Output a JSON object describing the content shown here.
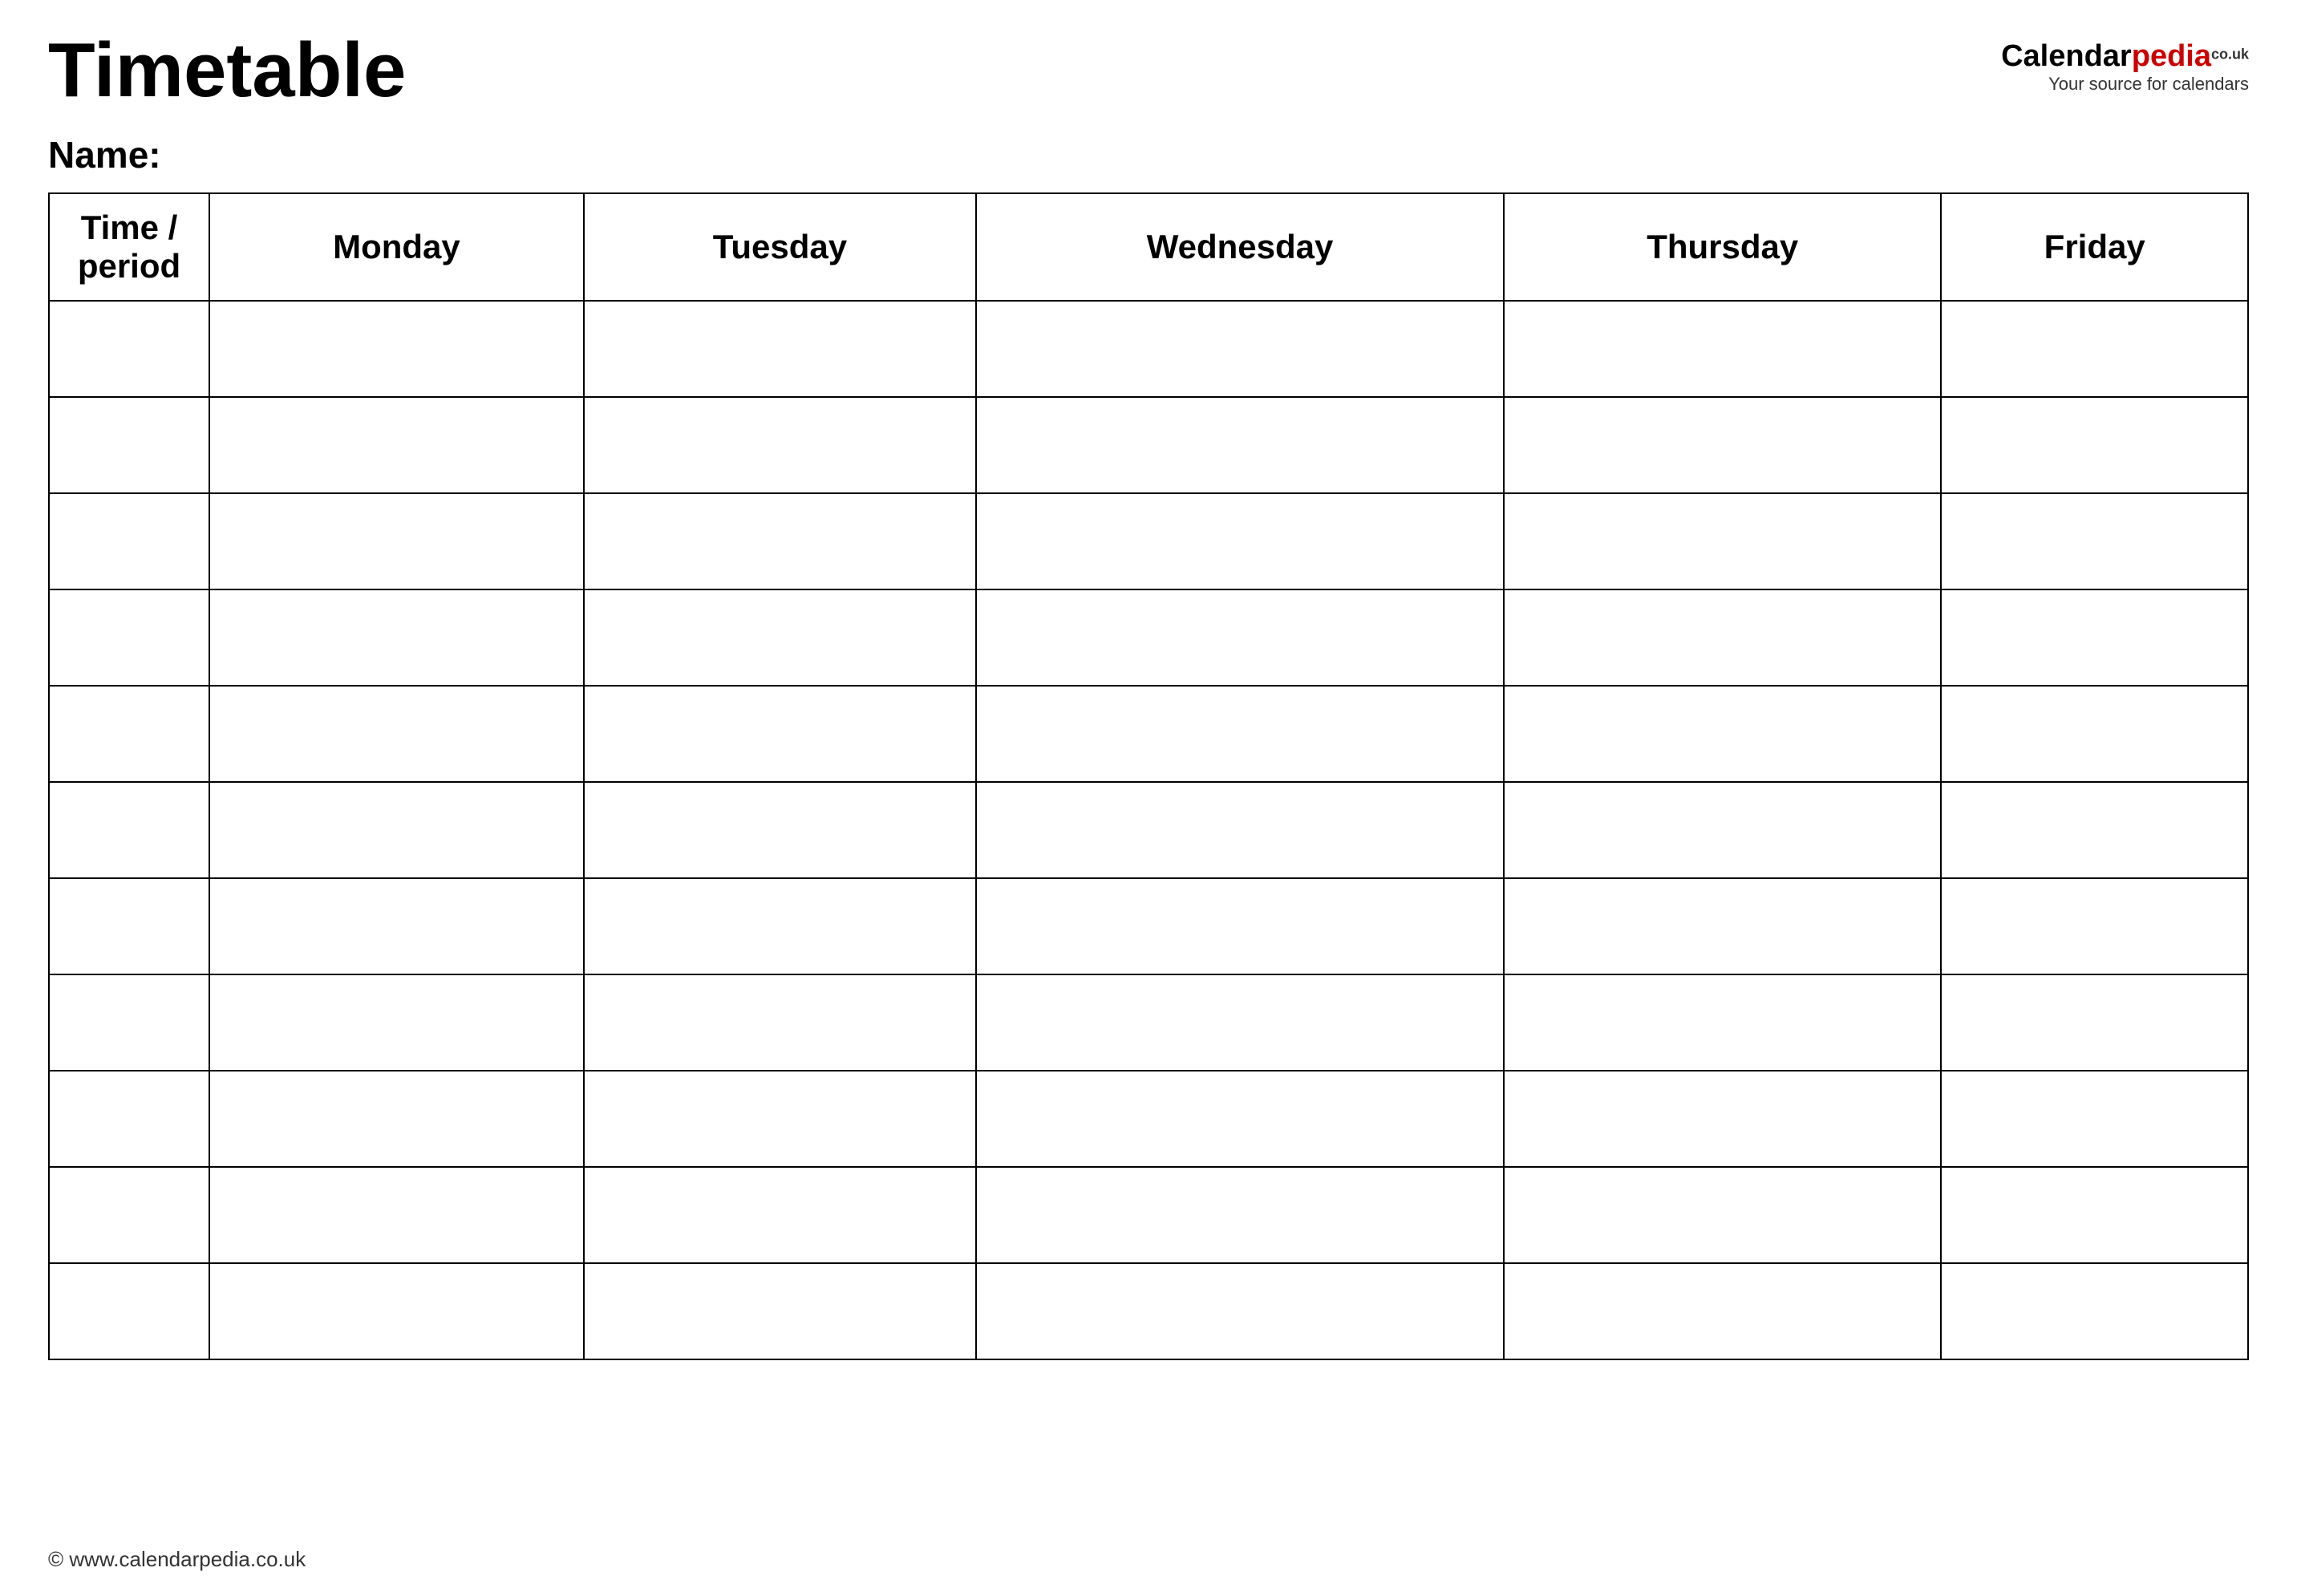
{
  "header": {
    "title": "Timetable",
    "logo": {
      "calendar": "Calendar",
      "pedia": "pedia",
      "couk": "co.uk",
      "tagline": "Your source for calendars"
    }
  },
  "name_label": "Name:",
  "table": {
    "columns": [
      {
        "key": "time",
        "label": "Time / period"
      },
      {
        "key": "monday",
        "label": "Monday"
      },
      {
        "key": "tuesday",
        "label": "Tuesday"
      },
      {
        "key": "wednesday",
        "label": "Wednesday"
      },
      {
        "key": "thursday",
        "label": "Thursday"
      },
      {
        "key": "friday",
        "label": "Friday"
      }
    ],
    "rows": 11
  },
  "footer": {
    "url": "© www.calendarpedia.co.uk"
  }
}
